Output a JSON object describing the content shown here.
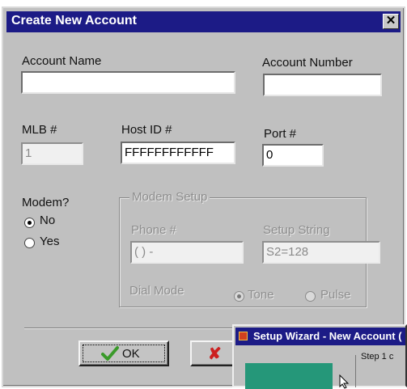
{
  "dialog": {
    "title": "Create New Account",
    "close_glyph": "✕",
    "colors": {
      "titlebar": "#1c1b86",
      "face": "#c0c0c0"
    }
  },
  "fields": {
    "account_name": {
      "label": "Account Name",
      "value": ""
    },
    "account_number": {
      "label": "Account Number",
      "value": ""
    },
    "mlb": {
      "label": "MLB #",
      "value": "1"
    },
    "host_id": {
      "label": "Host ID #",
      "value": "FFFFFFFFFFFF"
    },
    "port": {
      "label": "Port #",
      "value": "0"
    }
  },
  "modem": {
    "label": "Modem?",
    "options": [
      {
        "label": "No",
        "selected": true
      },
      {
        "label": "Yes",
        "selected": false
      }
    ]
  },
  "modem_setup": {
    "group_title": "Modem Setup",
    "phone": {
      "label": "Phone #",
      "value": "(  )   -"
    },
    "setup_string": {
      "label": "Setup String",
      "value": "S2=128"
    },
    "dial_mode": {
      "label": "Dial Mode",
      "options": [
        {
          "label": "Tone",
          "selected": true
        },
        {
          "label": "Pulse",
          "selected": false
        }
      ]
    }
  },
  "buttons": {
    "ok": {
      "label": "OK",
      "icon": "checkmark-icon",
      "icon_color": "#3a9a2a"
    },
    "cancel": {
      "icon": "x-icon",
      "icon_glyph": "✘",
      "icon_color": "#cc2020"
    }
  },
  "wizard": {
    "title": "Setup Wizard - New Account (",
    "step_text": "Step 1 c",
    "panel_color": "#259779"
  }
}
